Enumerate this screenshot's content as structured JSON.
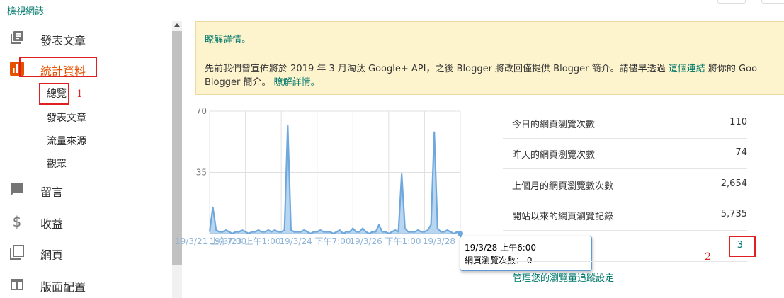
{
  "header": {
    "title": "檢視網誌"
  },
  "sidebar": {
    "items": [
      {
        "label": "發表文章",
        "icon": "posts-icon"
      },
      {
        "label": "統計資料",
        "icon": "stats-icon"
      },
      {
        "label": "留言",
        "icon": "comments-icon"
      },
      {
        "label": "收益",
        "icon": "earnings-icon"
      },
      {
        "label": "網頁",
        "icon": "pages-icon"
      },
      {
        "label": "版面配置",
        "icon": "layout-icon"
      }
    ],
    "stats_sub": [
      "總覽",
      "發表文章",
      "流量來源",
      "觀眾"
    ]
  },
  "notice": {
    "line1_link": "瞭解詳情。",
    "line2_before": "先前我們曾宣佈將於 2019 年 3 月淘汰 Google+ API，之後 Blogger 將改回僅提供 Blogger 簡介。請儘早透過 ",
    "line2_link": "這個連結",
    "line2_after": " 將你的 Goo",
    "line3_before": "Blogger 簡介。 ",
    "line3_link": "瞭解詳情。"
  },
  "chart_data": {
    "type": "line",
    "ylim": [
      0,
      70
    ],
    "yticks": [
      "70",
      "35"
    ],
    "xticks": [
      "19/3/21 上午7:00",
      "19/3/23 上午1:00",
      "19/3/24 下午7:00",
      "19/3/26 下午1:00",
      "19/3/28"
    ],
    "series": [
      {
        "values": [
          1,
          15,
          2,
          1,
          1,
          2,
          1,
          0,
          1,
          1,
          2,
          1,
          0,
          1,
          1,
          2,
          1,
          1,
          2,
          1,
          2,
          1,
          1,
          2,
          62,
          2,
          1,
          1,
          1,
          2,
          1,
          0,
          1,
          1,
          2,
          1,
          1,
          1,
          0,
          1,
          2,
          0,
          1,
          1,
          3,
          1,
          1,
          3,
          1,
          0,
          1,
          1,
          5,
          1,
          1,
          0,
          1,
          2,
          1,
          34,
          3,
          1,
          1,
          1,
          2,
          1,
          1,
          2,
          5,
          58,
          3,
          1,
          1,
          2,
          1,
          0,
          1,
          0
        ]
      }
    ],
    "tooltip": {
      "date": "19/3/28 上午6:00",
      "label": "網頁瀏覽次數：",
      "value": "0"
    },
    "color": "#6fa8dc"
  },
  "stats": [
    {
      "label": "今日的網頁瀏覽次數",
      "value": "110"
    },
    {
      "label": "昨天的網頁瀏覽次數",
      "value": "74"
    },
    {
      "label": "上個月的網頁瀏覽數次數",
      "value": "2,654"
    },
    {
      "label": "開站以來的網頁瀏覽記錄",
      "value": "5,735"
    },
    {
      "label": "",
      "value": "3"
    }
  ],
  "manage_link": "管理您的瀏覽量追蹤設定",
  "annotations": {
    "one": "1",
    "two": "2"
  },
  "colors": {
    "accent": "#e65100",
    "link": "#00796b",
    "highlight": "#e02020"
  }
}
